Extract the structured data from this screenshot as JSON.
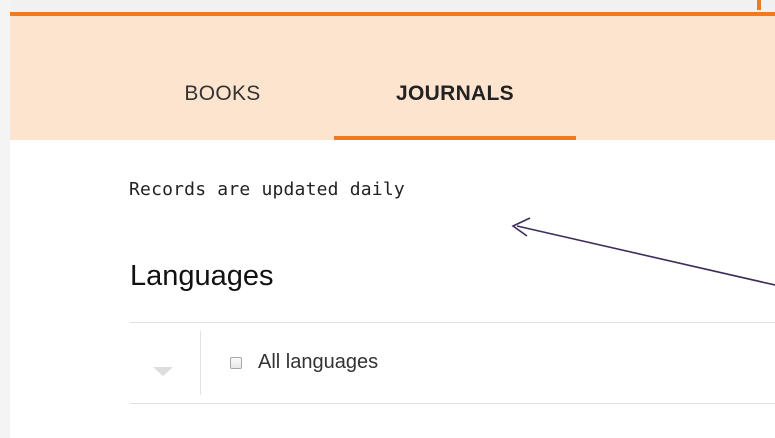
{
  "tabs": [
    {
      "label": "BOOKS",
      "active": false
    },
    {
      "label": "JOURNALS",
      "active": true
    }
  ],
  "info": {
    "text": "Records are updated daily"
  },
  "languages": {
    "title": "Languages",
    "toggle_icon": "chevron-down-icon",
    "all_option": {
      "label": "All languages",
      "checked": false
    }
  },
  "colors": {
    "accent": "#f07a1d",
    "tab_bar": "#fde4cf",
    "annotation_arrow": "#3d2d5c"
  }
}
